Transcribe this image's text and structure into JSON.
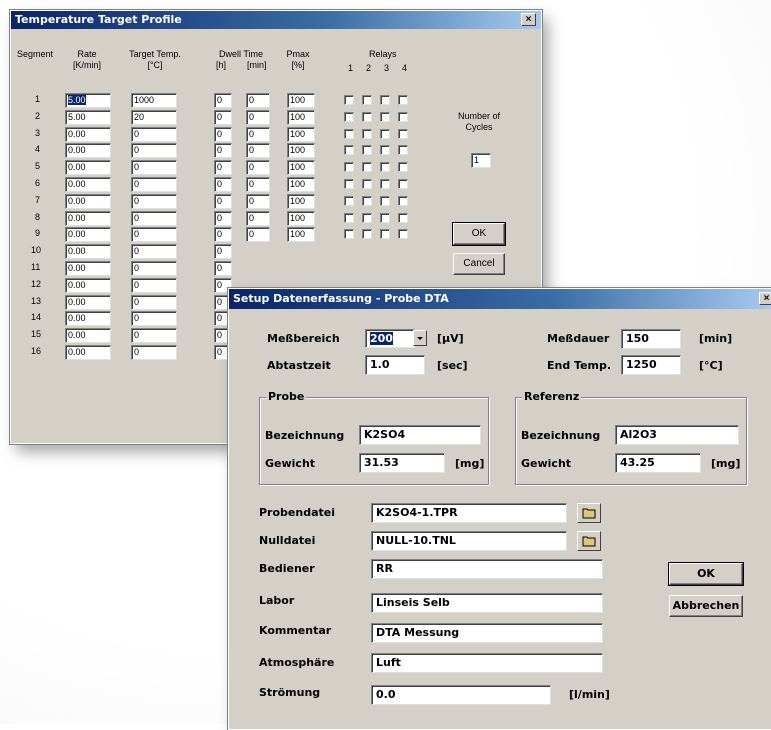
{
  "profile": {
    "title": "Temperature Target Profile",
    "close": "×",
    "headers": {
      "segment": "Segment",
      "rate": "Rate",
      "rate_unit": "[K/min]",
      "target": "Target Temp.",
      "target_unit": "[°C]",
      "dwell": "Dwell Time",
      "dwell_h": "[h]",
      "dwell_min": "[min]",
      "pmax": "Pmax",
      "pmax_unit": "[%]",
      "relays": "Relays",
      "relay_nums": [
        "1",
        "2",
        "3",
        "4"
      ]
    },
    "rows": [
      {
        "seg": "1",
        "rate": "5.00",
        "target": "1000",
        "h": "0",
        "min": "0",
        "pmax": "100"
      },
      {
        "seg": "2",
        "rate": "5.00",
        "target": "20",
        "h": "0",
        "min": "0",
        "pmax": "100"
      },
      {
        "seg": "3",
        "rate": "0.00",
        "target": "0",
        "h": "0",
        "min": "0",
        "pmax": "100"
      },
      {
        "seg": "4",
        "rate": "0.00",
        "target": "0",
        "h": "0",
        "min": "0",
        "pmax": "100"
      },
      {
        "seg": "5",
        "rate": "0.00",
        "target": "0",
        "h": "0",
        "min": "0",
        "pmax": "100"
      },
      {
        "seg": "6",
        "rate": "0.00",
        "target": "0",
        "h": "0",
        "min": "0",
        "pmax": "100"
      },
      {
        "seg": "7",
        "rate": "0.00",
        "target": "0",
        "h": "0",
        "min": "0",
        "pmax": "100"
      },
      {
        "seg": "8",
        "rate": "0.00",
        "target": "0",
        "h": "0",
        "min": "0",
        "pmax": "100"
      },
      {
        "seg": "9",
        "rate": "0.00",
        "target": "0",
        "h": "0",
        "min": "0",
        "pmax": "100"
      },
      {
        "seg": "10",
        "rate": "0.00",
        "target": "0",
        "h": "0",
        "min": "",
        "pmax": ""
      },
      {
        "seg": "11",
        "rate": "0.00",
        "target": "0",
        "h": "0",
        "min": "",
        "pmax": ""
      },
      {
        "seg": "12",
        "rate": "0.00",
        "target": "0",
        "h": "0",
        "min": "",
        "pmax": ""
      },
      {
        "seg": "13",
        "rate": "0.00",
        "target": "0",
        "h": "0",
        "min": "",
        "pmax": ""
      },
      {
        "seg": "14",
        "rate": "0.00",
        "target": "0",
        "h": "0",
        "min": "",
        "pmax": ""
      },
      {
        "seg": "15",
        "rate": "0.00",
        "target": "0",
        "h": "0",
        "min": "",
        "pmax": ""
      },
      {
        "seg": "16",
        "rate": "0.00",
        "target": "0",
        "h": "0",
        "min": "",
        "pmax": ""
      }
    ],
    "cycles_label_1": "Number of",
    "cycles_label_2": "Cycles",
    "cycles_value": "1",
    "ok": "OK",
    "cancel": "Cancel"
  },
  "setup": {
    "title": "Setup Datenerfassung - Probe DTA",
    "close": "×",
    "messbereich_label": "Meßbereich",
    "messbereich_value": "200",
    "messbereich_unit": "[µV]",
    "abtastzeit_label": "Abtastzeit",
    "abtastzeit_value": "1.0",
    "abtastzeit_unit": "[sec]",
    "messdauer_label": "Meßdauer",
    "messdauer_value": "150",
    "messdauer_unit": "[min]",
    "endtemp_label": "End Temp.",
    "endtemp_value": "1250",
    "endtemp_unit": "[°C]",
    "probe": {
      "title": "Probe",
      "bez_label": "Bezeichnung",
      "bez_value": "K2SO4",
      "gew_label": "Gewicht",
      "gew_value": "31.53",
      "gew_unit": "[mg]"
    },
    "referenz": {
      "title": "Referenz",
      "bez_label": "Bezeichnung",
      "bez_value": "Al2O3",
      "gew_label": "Gewicht",
      "gew_value": "43.25",
      "gew_unit": "[mg]"
    },
    "probendatei_label": "Probendatei",
    "probendatei_value": "K2SO4-1.TPR",
    "nulldatei_label": "Nulldatei",
    "nulldatei_value": "NULL-10.TNL",
    "bediener_label": "Bediener",
    "bediener_value": "RR",
    "labor_label": "Labor",
    "labor_value": "Linseis Selb",
    "kommentar_label": "Kommentar",
    "kommentar_value": "DTA Messung",
    "atmosphaere_label": "Atmosphäre",
    "atmosphaere_value": "Luft",
    "stroemung_label": "Strömung",
    "stroemung_value": "0.0",
    "stroemung_unit": "[l/min]",
    "ok": "OK",
    "abbrechen": "Abbrechen"
  },
  "colors": {
    "titlebar_start": "#0a246a",
    "titlebar_end": "#a6caf0",
    "dialog_face": "#d4d0c8",
    "selection": "#0a246a"
  }
}
